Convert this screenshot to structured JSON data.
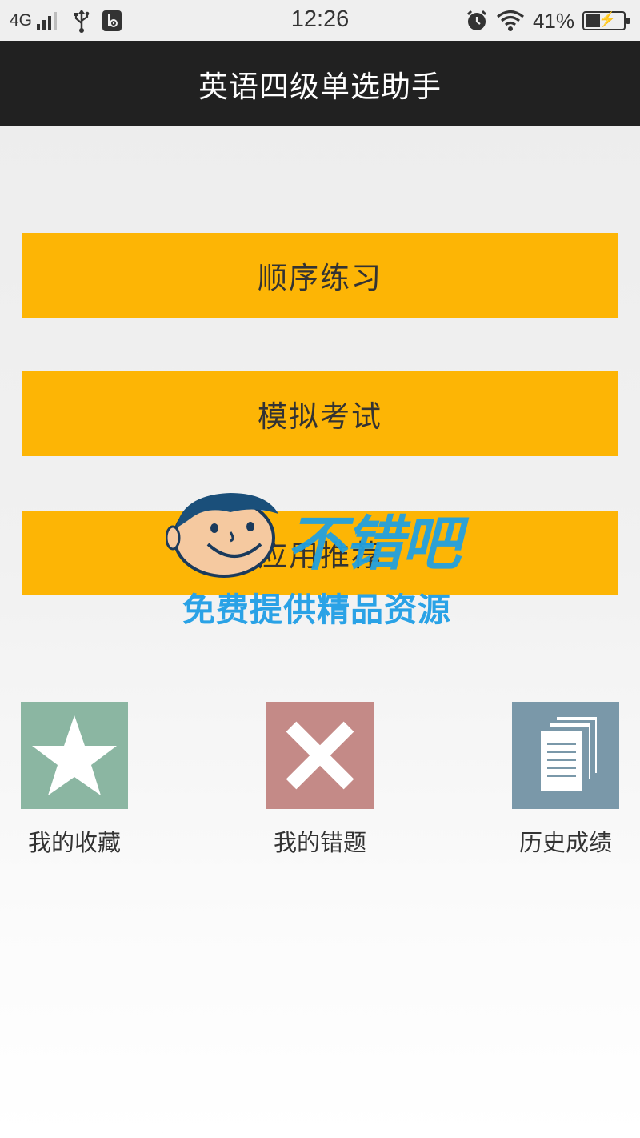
{
  "status_bar": {
    "network": "4G",
    "time": "12:26",
    "battery_percent": "41%",
    "icons": [
      "signal-icon",
      "usb-icon",
      "usb-debug-icon",
      "alarm-icon",
      "wifi-icon",
      "battery-charging-icon"
    ]
  },
  "app": {
    "title": "英语四级单选助手"
  },
  "menu": {
    "sequential_practice": "顺序练习",
    "mock_exam": "模拟考试",
    "app_recommend": "应用推荐"
  },
  "tiles": {
    "favorites": {
      "label": "我的收藏",
      "icon": "star-icon",
      "color": "#8bb6a2"
    },
    "wrong_questions": {
      "label": "我的错题",
      "icon": "cross-icon",
      "color": "#c48a87"
    },
    "history_scores": {
      "label": "历史成绩",
      "icon": "documents-icon",
      "color": "#7a98a9"
    }
  },
  "watermark": {
    "title": "不错吧",
    "subtitle": "免费提供精品资源"
  },
  "colors": {
    "title_bar": "#212121",
    "button": "#fdb505",
    "watermark": "#22a0e0"
  }
}
